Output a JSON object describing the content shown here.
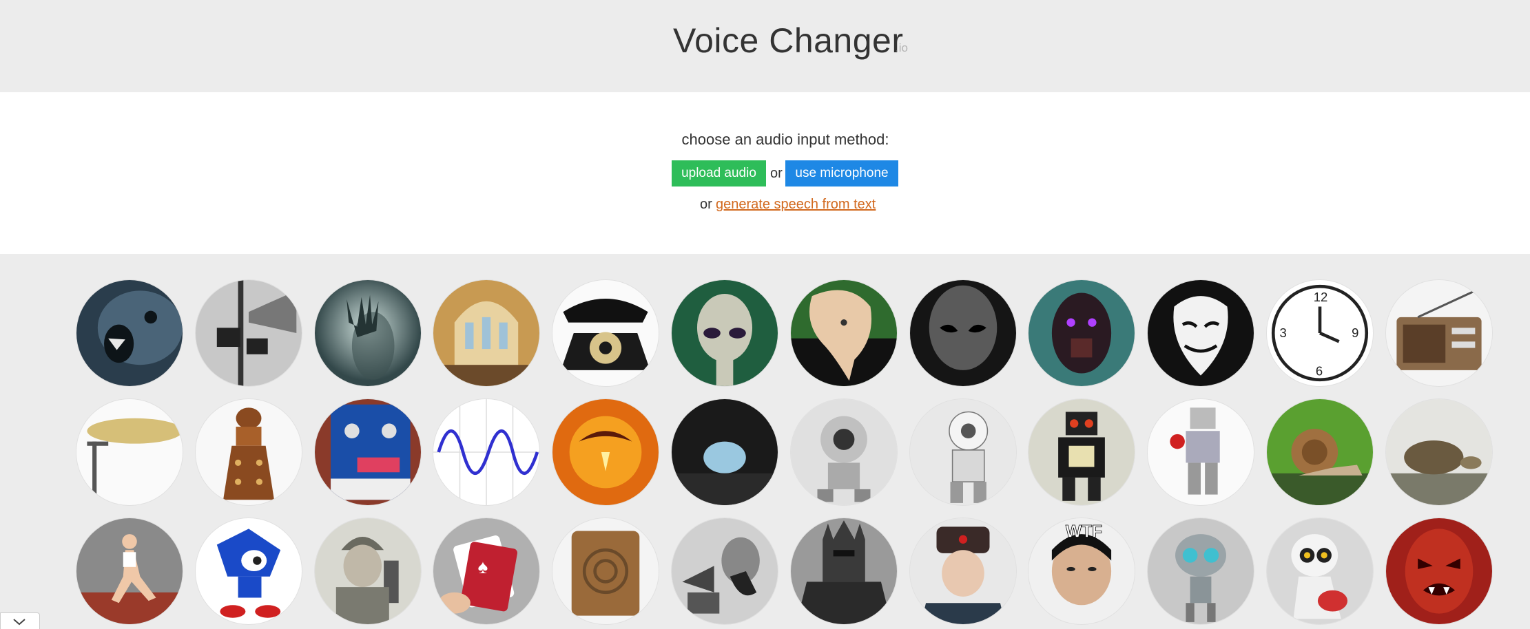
{
  "header": {
    "title": "Voice Changer",
    "title_suffix": ".io"
  },
  "input": {
    "prompt": "choose an audio input method:",
    "upload_label": "upload audio",
    "or_text": "or",
    "mic_label": "use microphone",
    "or_text_2": "or",
    "tts_link": "generate speech from text"
  },
  "voices": [
    "ogre-face-icon",
    "megaphone-icon",
    "ghost-hand-icon",
    "cathedral-icon",
    "rotary-phone-icon",
    "alien-icon",
    "melting-clock-icon",
    "dark-alien-icon",
    "cyber-robot-icon",
    "anonymous-mask-icon",
    "reverse-clock-icon",
    "radio-icon",
    "cymbal-icon",
    "dalek-icon",
    "effects-pedal-icon",
    "sine-wave-icon",
    "fire-demon-icon",
    "cave-icon",
    "robot-eye-icon",
    "white-robot-icon",
    "toy-robot-icon",
    "lego-robot-icon",
    "snail-icon",
    "tortoise-icon",
    "runner-icon",
    "sonic-icon",
    "soldier-radio-icon",
    "playing-cards-icon",
    "wooden-speaker-icon",
    "gramophone-man-icon",
    "dark-knight-icon",
    "soviet-officer-icon",
    "wtf-meme-icon",
    "gir-robot-icon",
    "kirobo-robot-icon",
    "red-devil-icon"
  ],
  "colors": {
    "upload": "#2ebd59",
    "mic": "#1e88e5",
    "link": "#d2691e",
    "header_bg": "#ececec"
  }
}
